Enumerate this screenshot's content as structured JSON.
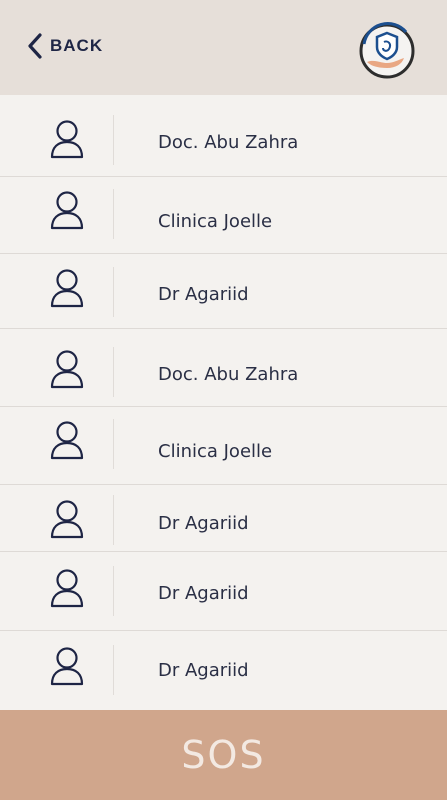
{
  "header": {
    "back_label": "BACK",
    "logo_icon": "shield-hand-logo-icon"
  },
  "contacts": [
    {
      "name": "Doc. Abu Zahra",
      "icon": "person-icon"
    },
    {
      "name": "Clinica Joelle",
      "icon": "person-icon"
    },
    {
      "name": "Dr Agariid",
      "icon": "person-icon"
    },
    {
      "name": "Doc. Abu Zahra",
      "icon": "person-icon"
    },
    {
      "name": "Clinica Joelle",
      "icon": "person-icon"
    },
    {
      "name": "Dr Agariid",
      "icon": "person-icon"
    },
    {
      "name": "Dr Agariid",
      "icon": "person-icon"
    },
    {
      "name": "Dr Agariid",
      "icon": "person-icon"
    }
  ],
  "sos": {
    "label": "SOS"
  },
  "colors": {
    "header_bg": "#e6dfd9",
    "list_bg": "#f4f2ef",
    "sos_bg": "#d0a68c",
    "text_dark": "#1e2545"
  }
}
